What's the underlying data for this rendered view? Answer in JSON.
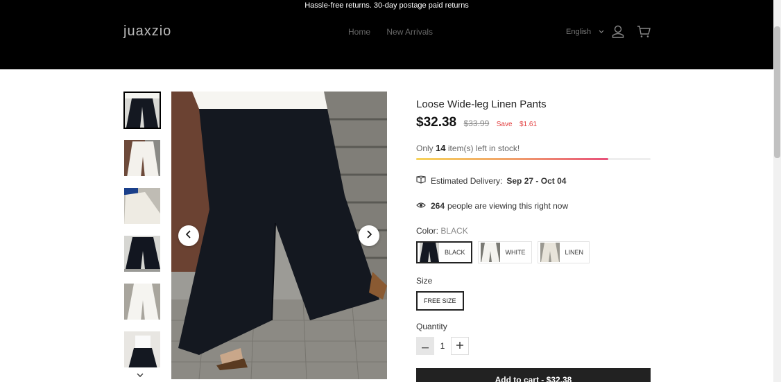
{
  "announcement": "Hassle-free returns. 30-day postage paid returns",
  "header": {
    "logo": "juaxzio",
    "nav": [
      "Home",
      "New Arrivals"
    ],
    "language": "English",
    "icons": [
      "user-icon",
      "cart-icon"
    ]
  },
  "gallery": {
    "thumbnails": [
      "black",
      "white",
      "white",
      "black",
      "white",
      "black-white-top"
    ],
    "active_index": 0,
    "icons": [
      "chevron-left-icon",
      "chevron-right-icon",
      "chevron-down-icon"
    ]
  },
  "product": {
    "title": "Loose Wide-leg Linen Pants",
    "price": "$32.38",
    "compare_price": "$33.99",
    "save_label": "Save",
    "save_amount": "$1.61",
    "stock_prefix": "Only",
    "stock_count": "14",
    "stock_suffix": "item(s) left in stock!",
    "stock_bar_fraction": 0.82,
    "delivery_label": "Estimated Delivery:",
    "delivery_dates": "Sep 27 - Oct 04",
    "viewing_count": "264",
    "viewing_text": "people are viewing this right now",
    "color_label": "Color:",
    "color_value": "BLACK",
    "colors": [
      "BLACK",
      "WHITE",
      "LINEN"
    ],
    "size_label": "Size",
    "sizes": [
      "FREE SIZE"
    ],
    "quantity_label": "Quantity",
    "quantity": "1",
    "add_to_cart": "Add to cart - $32.38"
  },
  "colors": {
    "header_bg": "#000000",
    "accent_red": "#e23b3b",
    "button_bg": "#222222",
    "stock_bar_gradient": [
      "#f7d35a",
      "#f0a06a",
      "#e8507a"
    ]
  }
}
